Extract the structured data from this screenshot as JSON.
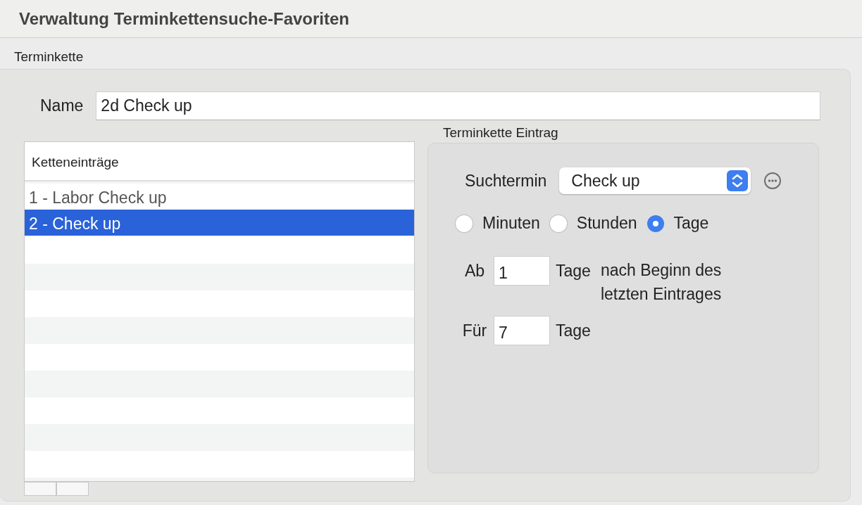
{
  "window": {
    "title": "Verwaltung Terminkettensuche-Favoriten"
  },
  "group": {
    "label": "Terminkette"
  },
  "name_field": {
    "label": "Name",
    "value": "2d Check up"
  },
  "list": {
    "header": "Ketteneinträge",
    "rows": [
      {
        "label": "1 - Labor Check up",
        "selected": false
      },
      {
        "label": "2 - Check up",
        "selected": true
      }
    ]
  },
  "entry": {
    "label": "Terminkette Eintrag",
    "search": {
      "label": "Suchtermin",
      "value": "Check up"
    },
    "units": [
      {
        "label": "Minuten",
        "selected": false
      },
      {
        "label": "Stunden",
        "selected": false
      },
      {
        "label": "Tage",
        "selected": true
      }
    ],
    "from": {
      "label": "Ab",
      "value": "1",
      "unit": "Tage",
      "note": "nach Beginn des letzten Eintrages"
    },
    "for": {
      "label": "Für",
      "value": "7",
      "unit": "Tage"
    }
  }
}
